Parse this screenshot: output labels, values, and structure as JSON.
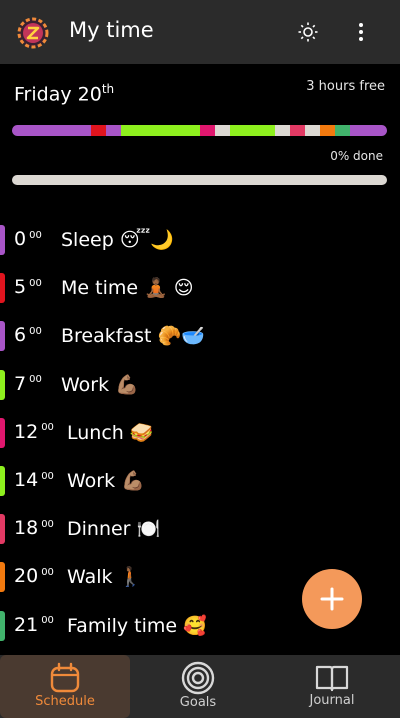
{
  "app": {
    "title": "My time"
  },
  "summary": {
    "day": "Friday 20",
    "day_suffix": "th",
    "free_time": "3 hours free",
    "progress_label": "0% done",
    "progress_fraction": 0
  },
  "timeline_segments": [
    {
      "color": "#a855c7",
      "fraction": 0.21
    },
    {
      "color": "#e0141e",
      "fraction": 0.04
    },
    {
      "color": "#a855c7",
      "fraction": 0.04
    },
    {
      "color": "#8ef01e",
      "fraction": 0.21
    },
    {
      "color": "#e0176e",
      "fraction": 0.04
    },
    {
      "color": "#dcd8d2",
      "fraction": 0.04
    },
    {
      "color": "#8ef01e",
      "fraction": 0.12
    },
    {
      "color": "#dcd8d2",
      "fraction": 0.04
    },
    {
      "color": "#e23a64",
      "fraction": 0.04
    },
    {
      "color": "#dcd8d2",
      "fraction": 0.04
    },
    {
      "color": "#f27a0f",
      "fraction": 0.04
    },
    {
      "color": "#41b36c",
      "fraction": 0.04
    },
    {
      "color": "#a855c7",
      "fraction": 0.1
    }
  ],
  "schedule": [
    {
      "hour": "0",
      "minutes": "00",
      "label": "Sleep 😴🌙",
      "color": "#a855c7"
    },
    {
      "hour": "5",
      "minutes": "00",
      "label": "Me time 🧘🏾 😌",
      "color": "#e0141e"
    },
    {
      "hour": "6",
      "minutes": "00",
      "label": "Breakfast 🥐🥣",
      "color": "#a855c7"
    },
    {
      "hour": "7",
      "minutes": "00",
      "label": "Work 💪🏽",
      "color": "#8ef01e"
    },
    {
      "hour": "12",
      "minutes": "00",
      "label": "Lunch 🥪",
      "color": "#e0176e"
    },
    {
      "hour": "14",
      "minutes": "00",
      "label": "Work 💪🏽",
      "color": "#8ef01e"
    },
    {
      "hour": "18",
      "minutes": "00",
      "label": "Dinner 🍽️",
      "color": "#e23a64"
    },
    {
      "hour": "20",
      "minutes": "00",
      "label": "Walk 🚶🏾",
      "color": "#f27a0f"
    },
    {
      "hour": "21",
      "minutes": "00",
      "label": "Family time 🥰",
      "color": "#41b36c"
    }
  ],
  "nav": {
    "schedule": "Schedule",
    "goals": "Goals",
    "journal": "Journal"
  },
  "colors": {
    "accent": "#f08a3a",
    "bar_background": "#2b2b2b"
  }
}
